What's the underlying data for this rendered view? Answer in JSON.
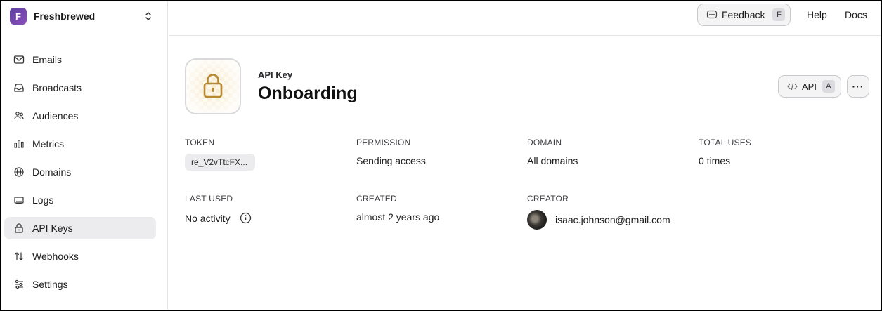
{
  "team": {
    "initial": "F",
    "name": "Freshbrewed"
  },
  "sidebar": {
    "items": [
      {
        "label": "Emails",
        "icon": "mail-icon",
        "active": false
      },
      {
        "label": "Broadcasts",
        "icon": "inbox-icon",
        "active": false
      },
      {
        "label": "Audiences",
        "icon": "users-icon",
        "active": false
      },
      {
        "label": "Metrics",
        "icon": "bar-chart-icon",
        "active": false
      },
      {
        "label": "Domains",
        "icon": "globe-icon",
        "active": false
      },
      {
        "label": "Logs",
        "icon": "logs-icon",
        "active": false
      },
      {
        "label": "API Keys",
        "icon": "lock-icon",
        "active": true
      },
      {
        "label": "Webhooks",
        "icon": "arrows-updown-icon",
        "active": false
      },
      {
        "label": "Settings",
        "icon": "sliders-icon",
        "active": false
      }
    ]
  },
  "topbar": {
    "feedback_label": "Feedback",
    "feedback_shortcut": "F",
    "help_label": "Help",
    "docs_label": "Docs"
  },
  "header": {
    "kind": "API Key",
    "title": "Onboarding",
    "api_label": "API",
    "api_shortcut": "A",
    "more_label": "···"
  },
  "details": {
    "token_label": "TOKEN",
    "token_value": "re_V2vTtcFX...",
    "permission_label": "PERMISSION",
    "permission_value": "Sending access",
    "domain_label": "DOMAIN",
    "domain_value": "All domains",
    "total_uses_label": "TOTAL USES",
    "total_uses_value": "0 times",
    "last_used_label": "LAST USED",
    "last_used_value": "No activity",
    "created_label": "CREATED",
    "created_value": "almost 2 years ago",
    "creator_label": "CREATOR",
    "creator_value": "isaac.johnson@gmail.com"
  },
  "colors": {
    "active_nav_bg": "#ececee",
    "lock_gold": "#b8892e",
    "team_logo": "#6b46b0"
  }
}
